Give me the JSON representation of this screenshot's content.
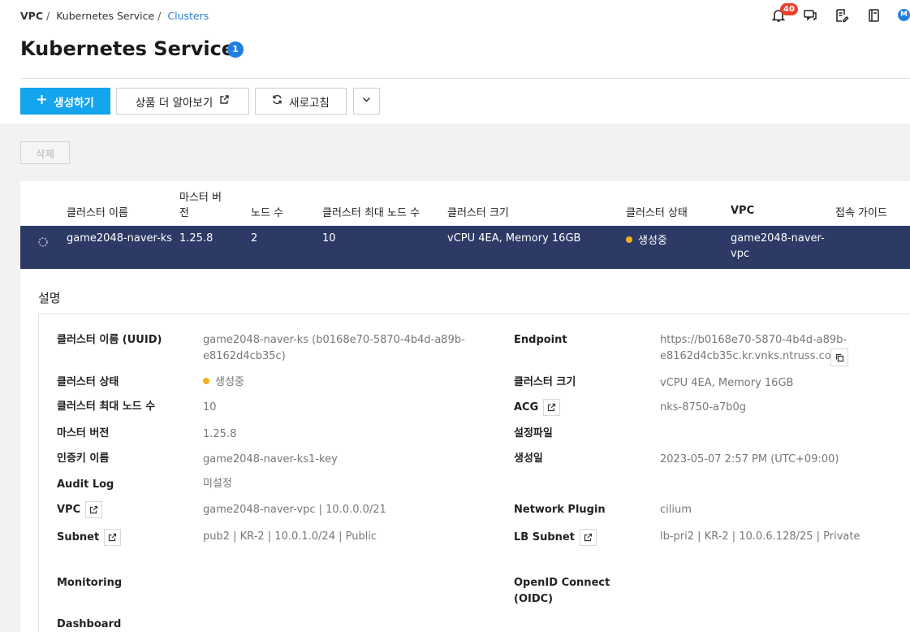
{
  "breadcrumb": [
    "VPC",
    "Kubernetes Service",
    "Clusters"
  ],
  "breadcrumb_sep": "/",
  "notifications": {
    "count": "40"
  },
  "user": {
    "initial": "M"
  },
  "page": {
    "title": "Kubernetes Service",
    "count": "1"
  },
  "toolbar": {
    "create": "생성하기",
    "learn_more": "상품 더 알아보기",
    "refresh": "새로고침"
  },
  "actions": {
    "delete": "삭제"
  },
  "table": {
    "headers": {
      "name": "클러스터 이름",
      "master_version": "마스터 버전",
      "master_version_l1": "마스터 버",
      "master_version_l2": "전",
      "node_count": "노드 수",
      "max_nodes": "클러스터 최대 노드 수",
      "size": "클러스터 크기",
      "status": "클러스터 상태",
      "vpc": "VPC",
      "guide": "접속 가이드"
    },
    "rows": [
      {
        "name": "game2048-naver-ks",
        "master_version": "1.25.8",
        "node_count": "2",
        "max_nodes": "10",
        "size": "vCPU 4EA, Memory 16GB",
        "status": "생성중",
        "vpc_l1": "game2048-naver-",
        "vpc_l2": "vpc"
      }
    ]
  },
  "detail": {
    "title": "설명",
    "labels": {
      "uuid": "클러스터 이름 (UUID)",
      "status": "클러스터 상태",
      "max_nodes": "클러스터 최대 노드 수",
      "master_version": "마스터 버전",
      "auth_key": "인증키 이름",
      "audit_log": "Audit Log",
      "vpc": "VPC",
      "subnet": "Subnet",
      "monitoring": "Monitoring",
      "dashboard": "Dashboard",
      "endpoint": "Endpoint",
      "size": "클러스터 크기",
      "acg": "ACG",
      "config": "설정파일",
      "created": "생성일",
      "network_plugin": "Network Plugin",
      "lb_subnet": "LB Subnet",
      "oidc_l1": "OpenID Connect",
      "oidc_l2": "(OIDC)"
    },
    "values": {
      "uuid_l1": "game2048-naver-ks (b0168e70-5870-4b4d-a89b-",
      "uuid_l2": "e8162d4cb35c)",
      "status": "생성중",
      "max_nodes": "10",
      "master_version": "1.25.8",
      "auth_key": "game2048-naver-ks1-key",
      "audit_log": "미설정",
      "vpc": "game2048-naver-vpc | 10.0.0.0/21",
      "subnet": "pub2 | KR-2 | 10.0.1.0/24 | Public",
      "endpoint_l1": "https://b0168e70-5870-4b4d-a89b-",
      "endpoint_l2": "e8162d4cb35c.kr.vnks.ntruss.com",
      "size": "vCPU 4EA, Memory 16GB",
      "acg": "nks-8750-a7b0g",
      "created": "2023-05-07 2:57 PM (UTC+09:00)",
      "network_plugin": "cilium",
      "lb_subnet": "lb-pri2 | KR-2 | 10.0.6.128/25 | Private"
    }
  },
  "colors": {
    "primary": "#15a4ee",
    "selected_row": "#2d3a66",
    "status_dot": "#f2b01e",
    "badge": "#e8422f",
    "link": "#2b7fd6"
  }
}
